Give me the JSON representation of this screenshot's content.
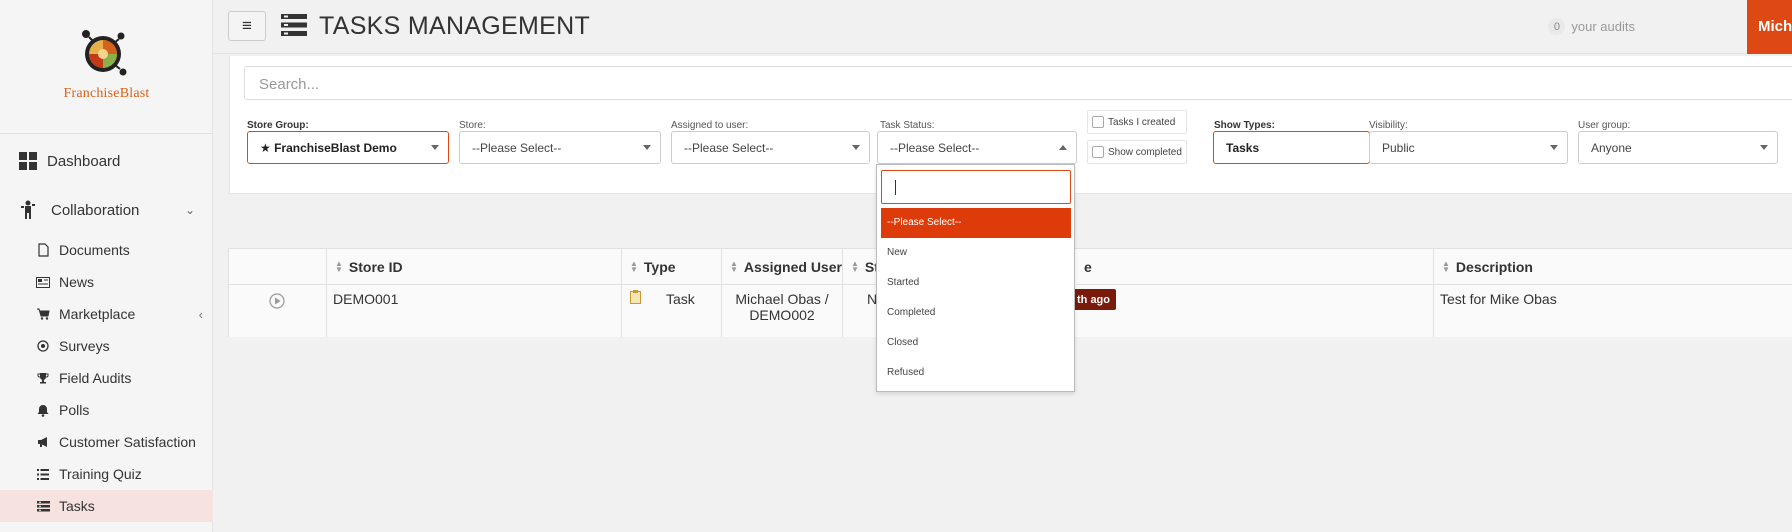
{
  "brand": {
    "name_first": "Franchise",
    "name_second": "Blast"
  },
  "sidebar": {
    "dashboard": "Dashboard",
    "collaboration": "Collaboration",
    "items": [
      {
        "label": "Documents",
        "icon": "file-icon"
      },
      {
        "label": "News",
        "icon": "newspaper-icon"
      },
      {
        "label": "Marketplace",
        "icon": "cart-icon"
      },
      {
        "label": "Surveys",
        "icon": "target-icon"
      },
      {
        "label": "Field Audits",
        "icon": "trophy-icon"
      },
      {
        "label": "Polls",
        "icon": "bell-icon"
      },
      {
        "label": "Customer Satisfaction",
        "icon": "megaphone-icon"
      },
      {
        "label": "Training Quiz",
        "icon": "list-icon"
      },
      {
        "label": "Tasks",
        "icon": "tasks-icon"
      }
    ]
  },
  "header": {
    "title": "TASKS MANAGEMENT",
    "audits_count": "0",
    "audits_label": "your audits",
    "user": "Michael Obas"
  },
  "filters": {
    "search_placeholder": "Search...",
    "store_group_label": "Store Group:",
    "store_group_value": "★ FranchiseBlast Demo",
    "store_label": "Store:",
    "store_value": "--Please Select--",
    "assigned_label": "Assigned to user:",
    "assigned_value": "--Please Select--",
    "status_label": "Task Status:",
    "status_value": "--Please Select--",
    "tasks_created": "Tasks I created",
    "show_completed": "Show completed",
    "show_types_label": "Show Types:",
    "show_types_value": "Tasks",
    "visibility_label": "Visibility:",
    "visibility_value": "Public",
    "user_group_label": "User group:",
    "user_group_value": "Anyone"
  },
  "status_dropdown": {
    "search_value": "",
    "options": [
      "--Please Select--",
      "New",
      "Started",
      "Completed",
      "Closed",
      "Refused"
    ],
    "selected": "--Please Select--"
  },
  "table": {
    "columns": [
      "Store ID",
      "Type",
      "Assigned User",
      "St",
      "e",
      "Description"
    ],
    "rows": [
      {
        "store_id": "DEMO001",
        "type": "Task",
        "assigned_user": "Michael Obas / DEMO002",
        "status": "N",
        "date": "th ago",
        "description": "Test for Mike Obas"
      }
    ]
  },
  "colors": {
    "accent": "#dd4814",
    "active_bg": "#f6e3e0",
    "date_badge": "#7a1a0a"
  }
}
